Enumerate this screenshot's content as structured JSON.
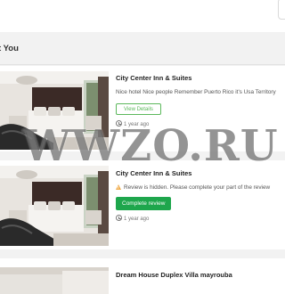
{
  "section": {
    "title": "t You"
  },
  "reviews": [
    {
      "hotel": "City Center Inn & Suites",
      "description": "Nice hotel Nice people Remember Puerto Rico it's Usa Territory",
      "button_label": "View Details",
      "time_ago": "1 year ago"
    },
    {
      "hotel": "City Center Inn & Suites",
      "notice": "Review is hidden. Please complete your part of the review",
      "button_label": "Complete review",
      "time_ago": "1 year ago"
    },
    {
      "hotel": "Dream House Duplex Villa mayrouba"
    }
  ],
  "watermark": {
    "text": "WWZO.RU"
  },
  "icons": {
    "clock": "clock-icon",
    "warning": "warning-icon"
  },
  "colors": {
    "accent_green": "#1ea64c",
    "outline_green": "#5cb85c",
    "warning": "#f0ad4e"
  }
}
